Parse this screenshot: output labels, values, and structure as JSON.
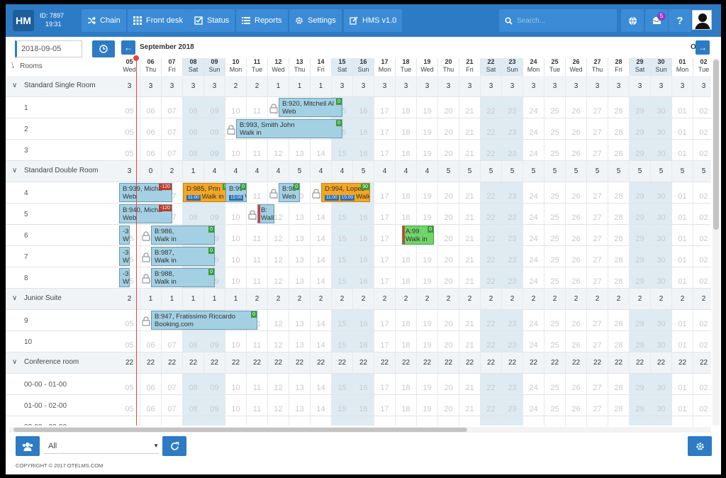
{
  "header": {
    "logo": "HM",
    "id_label": "ID: 7897",
    "time": "19:31",
    "nav": [
      {
        "label": "Chain",
        "icon": "shuffle-icon"
      },
      {
        "label": "Front desk",
        "icon": "grid-icon"
      },
      {
        "label": "Status",
        "icon": "checkbox-icon"
      },
      {
        "label": "Reports",
        "icon": "list-icon"
      },
      {
        "label": "Settings",
        "icon": "gear-icon"
      },
      {
        "label": "HMS v1.0",
        "icon": "edit-icon"
      }
    ],
    "search_placeholder": "Search...",
    "notification_count": "5",
    "help_label": "?"
  },
  "toolbar": {
    "date": "2018-09-05",
    "rooms_label": "Rooms",
    "month_label": "September 2018",
    "next_month_label": "O"
  },
  "days": [
    {
      "d": "05",
      "w": "Wed"
    },
    {
      "d": "06",
      "w": "Thu"
    },
    {
      "d": "07",
      "w": "Fri"
    },
    {
      "d": "08",
      "w": "Sat",
      "weekend": true
    },
    {
      "d": "09",
      "w": "Sun",
      "weekend": true
    },
    {
      "d": "10",
      "w": "Mon"
    },
    {
      "d": "11",
      "w": "Tue"
    },
    {
      "d": "12",
      "w": "Wed"
    },
    {
      "d": "13",
      "w": "Thu"
    },
    {
      "d": "14",
      "w": "Fri"
    },
    {
      "d": "15",
      "w": "Sat",
      "weekend": true
    },
    {
      "d": "16",
      "w": "Sun",
      "weekend": true
    },
    {
      "d": "17",
      "w": "Mon"
    },
    {
      "d": "18",
      "w": "Tue"
    },
    {
      "d": "19",
      "w": "Wed"
    },
    {
      "d": "20",
      "w": "Thu"
    },
    {
      "d": "21",
      "w": "Fri"
    },
    {
      "d": "22",
      "w": "Sat",
      "weekend": true
    },
    {
      "d": "23",
      "w": "Sun",
      "weekend": true
    },
    {
      "d": "24",
      "w": "Mon"
    },
    {
      "d": "25",
      "w": "Tue"
    },
    {
      "d": "26",
      "w": "Wed"
    },
    {
      "d": "27",
      "w": "Thu"
    },
    {
      "d": "28",
      "w": "Fri"
    },
    {
      "d": "29",
      "w": "Sat",
      "weekend": true
    },
    {
      "d": "30",
      "w": "Sun",
      "weekend": true
    },
    {
      "d": "01",
      "w": "Mon"
    },
    {
      "d": "02",
      "w": "Tue"
    }
  ],
  "rows": [
    {
      "type": "cat",
      "label": "Standard Single Room",
      "counts": [
        "3",
        "3",
        "3",
        "3",
        "3",
        "2",
        "2",
        "1",
        "1",
        "1",
        "3",
        "3",
        "3",
        "3",
        "3",
        "3",
        "3",
        "3",
        "3",
        "3",
        "3",
        "3",
        "3",
        "3",
        "3",
        "3",
        "3",
        "3"
      ]
    },
    {
      "type": "room",
      "label": "1"
    },
    {
      "type": "room",
      "label": "2"
    },
    {
      "type": "room",
      "label": "3"
    },
    {
      "type": "cat",
      "label": "Standard Double Room",
      "counts": [
        "3",
        "0",
        "2",
        "1",
        "4",
        "4",
        "4",
        "4",
        "5",
        "4",
        "4",
        "5",
        "4",
        "4",
        "4",
        "5",
        "5",
        "5",
        "5",
        "5",
        "5",
        "5",
        "5",
        "5",
        "5",
        "5",
        "5",
        "5"
      ]
    },
    {
      "type": "room",
      "label": "4"
    },
    {
      "type": "room",
      "label": "5"
    },
    {
      "type": "room",
      "label": "6"
    },
    {
      "type": "room",
      "label": "7"
    },
    {
      "type": "room",
      "label": "8"
    },
    {
      "type": "cat",
      "label": "Junior Suite",
      "counts": [
        "2",
        "1",
        "1",
        "1",
        "1",
        "1",
        "2",
        "2",
        "2",
        "2",
        "2",
        "2",
        "2",
        "2",
        "2",
        "2",
        "2",
        "2",
        "2",
        "2",
        "2",
        "2",
        "2",
        "2",
        "2",
        "2",
        "2",
        "2"
      ]
    },
    {
      "type": "room",
      "label": "9"
    },
    {
      "type": "room",
      "label": "10"
    },
    {
      "type": "cat",
      "label": "Conference room",
      "counts": [
        "22",
        "22",
        "22",
        "22",
        "22",
        "22",
        "22",
        "22",
        "22",
        "22",
        "22",
        "22",
        "22",
        "22",
        "22",
        "22",
        "22",
        "22",
        "22",
        "22",
        "22",
        "22",
        "22",
        "22",
        "22",
        "22",
        "22",
        "22"
      ]
    },
    {
      "type": "room",
      "label": "00-00 - 01-00"
    },
    {
      "type": "room",
      "label": "01-00 - 02-00"
    },
    {
      "type": "room",
      "label": "02-00 - 03-00"
    }
  ],
  "bookings": [
    {
      "row": 1,
      "start": 7.5,
      "len": 3,
      "line1": "B:920, Mitchell Al",
      "line2": "Web",
      "tag": "0",
      "tagcolor": "g",
      "lock": true
    },
    {
      "row": 2,
      "start": 5.5,
      "len": 5,
      "line1": "B:993, Smith John",
      "line2": "Walk in",
      "tag": "0",
      "tagcolor": "g",
      "lock": true
    },
    {
      "row": 5,
      "start": 0,
      "len": 2.5,
      "line1": "B:939, Micha",
      "line2": "Web",
      "tag": "-120",
      "tagcolor": "r"
    },
    {
      "row": 5,
      "start": 3,
      "len": 2.3,
      "line1": "D:985, Prin",
      "line2": "Walk in",
      "tag": "90",
      "tagcolor": "g",
      "style": "orange",
      "times": [
        "11:00"
      ]
    },
    {
      "row": 5,
      "start": 5,
      "len": 1,
      "line1": "B:99",
      "line2": "Web",
      "tag": "0",
      "tagcolor": "g",
      "times": [
        "15:00"
      ]
    },
    {
      "row": 5,
      "start": 7.5,
      "len": 1,
      "line1": "B:98",
      "line2": "Web",
      "tag": "0",
      "tagcolor": "g",
      "lock": true
    },
    {
      "row": 5,
      "start": 9.5,
      "len": 2.3,
      "line1": "D:994, Lopez",
      "line2": "Walk in",
      "tag": "90",
      "tagcolor": "g",
      "style": "orange",
      "lock": true,
      "times": [
        "11:00",
        "15:00"
      ]
    },
    {
      "row": 6,
      "start": 0,
      "len": 2.5,
      "line1": "B:940, Micha",
      "line2": "Web",
      "tag": "-120",
      "tagcolor": "r"
    },
    {
      "row": 6,
      "start": 6.5,
      "len": 0.8,
      "line1": "B:",
      "line2": "Walk",
      "tag": "",
      "tagcolor": "g",
      "lock": true,
      "lbar": true
    },
    {
      "row": 7,
      "start": 0,
      "len": 0.5,
      "line1": "-30",
      "line2": "Wa",
      "tag": "",
      "tagcolor": "r"
    },
    {
      "row": 7,
      "start": 1.5,
      "len": 3,
      "line1": "B:986,",
      "line2": "Walk in",
      "tag": "0",
      "tagcolor": "g",
      "lock": true
    },
    {
      "row": 7,
      "start": 13.3,
      "len": 1.5,
      "line1": "A:99",
      "line2": "Walk in",
      "tag": "0",
      "tagcolor": "g",
      "style": "green",
      "lbar": true
    },
    {
      "row": 8,
      "start": 0,
      "len": 0.5,
      "line1": "-30",
      "line2": "Wa",
      "tag": "",
      "tagcolor": "r"
    },
    {
      "row": 8,
      "start": 1.5,
      "len": 3,
      "line1": "B:987,",
      "line2": "Walk in",
      "tag": "0",
      "tagcolor": "g",
      "lock": true
    },
    {
      "row": 9,
      "start": 0,
      "len": 0.5,
      "line1": "-30",
      "line2": "Wa",
      "tag": "",
      "tagcolor": "r"
    },
    {
      "row": 9,
      "start": 1.5,
      "len": 3,
      "line1": "B:988,",
      "line2": "Walk in",
      "tag": "0",
      "tagcolor": "g",
      "lock": true
    },
    {
      "row": 11,
      "start": 1.5,
      "len": 5,
      "line1": "B:947, Fratissimo Riccardo",
      "line2": "Booking.com",
      "tag": "0",
      "tagcolor": "g",
      "lock": true
    }
  ],
  "bottom": {
    "filter_value": "All",
    "copyright": "COPYRIGHT © 2017 OTELMS.COM"
  },
  "colors": {
    "accent": "#2d7bc4",
    "weekend": "#deebf3",
    "booking": "#a3d0e3",
    "orange": "#f4a623",
    "green": "#70d46a",
    "today": "#e34545"
  }
}
